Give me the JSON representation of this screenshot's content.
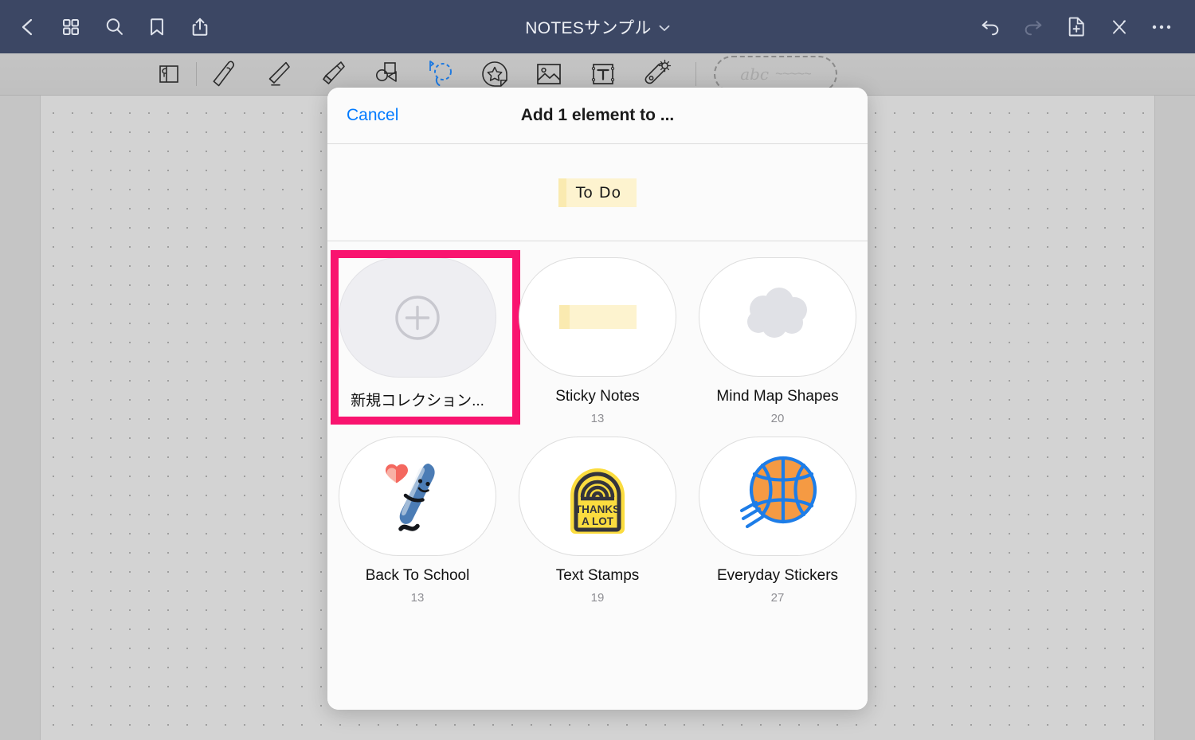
{
  "navbar": {
    "title": "NOTESサンプル",
    "left_items": [
      {
        "name": "back-icon",
        "label": "Back"
      },
      {
        "name": "grid-icon",
        "label": "Pages"
      },
      {
        "name": "search-icon",
        "label": "Search"
      },
      {
        "name": "bookmark-icon",
        "label": "Bookmark"
      },
      {
        "name": "share-icon",
        "label": "Share"
      }
    ],
    "right_items": [
      {
        "name": "undo-icon",
        "label": "Undo"
      },
      {
        "name": "redo-icon",
        "label": "Redo"
      },
      {
        "name": "add-page-icon",
        "label": "Add page"
      },
      {
        "name": "close-pen-icon",
        "label": "Close"
      },
      {
        "name": "more-icon",
        "label": "More"
      }
    ],
    "accent": "#3c4764"
  },
  "toolbar": {
    "tools": [
      {
        "name": "read-only-icon",
        "label": "Read only",
        "selected": false
      },
      {
        "name": "pen-icon",
        "label": "Pen",
        "selected": false
      },
      {
        "name": "eraser-icon",
        "label": "Eraser",
        "selected": false
      },
      {
        "name": "highlighter-icon",
        "label": "Highlighter",
        "selected": false
      },
      {
        "name": "shapes-icon",
        "label": "Shapes",
        "selected": false
      },
      {
        "name": "lasso-icon",
        "label": "Lasso",
        "selected": true
      },
      {
        "name": "sticker-icon",
        "label": "Stickers",
        "selected": false
      },
      {
        "name": "image-icon",
        "label": "Image",
        "selected": false
      },
      {
        "name": "text-icon",
        "label": "Text",
        "selected": false
      },
      {
        "name": "magic-icon",
        "label": "Magic",
        "selected": false
      }
    ],
    "selection_preview": {
      "abc": "abc",
      "squiggle": "~~~~~"
    },
    "selected_color": "#1f7ae0"
  },
  "modal": {
    "cancel_label": "Cancel",
    "title": "Add 1 element to ...",
    "preview_sticky_label": "To Do",
    "collections": [
      {
        "label": "新規コレクション...",
        "count": "",
        "thumb": "plus-circle-icon",
        "selected": true
      },
      {
        "label": "Sticky Notes",
        "count": "13",
        "thumb": "sticky-note-thumb",
        "selected": false
      },
      {
        "label": "Mind Map Shapes",
        "count": "20",
        "thumb": "cloud-shape-thumb",
        "selected": false
      },
      {
        "label": "Back To School",
        "count": "13",
        "thumb": "pen-heart-thumb",
        "selected": false
      },
      {
        "label": "Text Stamps",
        "count": "19",
        "thumb": "thanks-a-lot-stamp-thumb",
        "selected": false
      },
      {
        "label": "Everyday Stickers",
        "count": "27",
        "thumb": "basketball-thumb",
        "selected": false
      }
    ],
    "highlight_color": "#f9146f"
  },
  "stamp": {
    "line1": "THANKS",
    "line2": "A LOT"
  }
}
